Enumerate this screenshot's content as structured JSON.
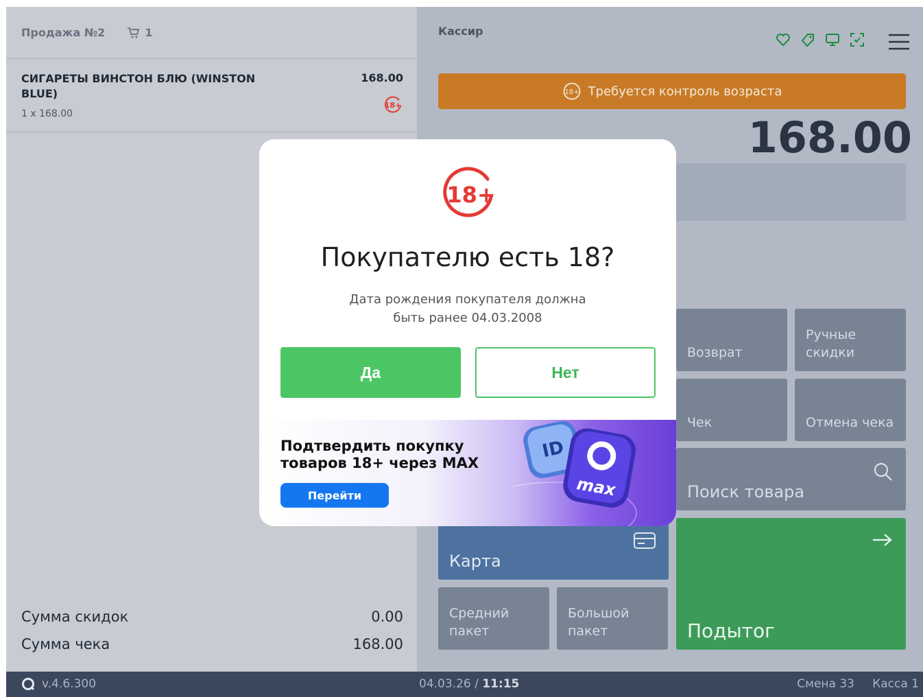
{
  "sale": {
    "title": "Продажа №2",
    "cart_count": "1"
  },
  "item": {
    "name": "СИГАРЕТЫ ВИНСТОН БЛЮ (WINSTON BLUE)",
    "price": "168.00",
    "qty_line": "1 x 168.00",
    "age_badge": "18+"
  },
  "totals": {
    "discount_label": "Сумма скидок",
    "discount_value": "0.00",
    "total_label": "Сумма чека",
    "total_value": "168.00"
  },
  "header": {
    "cashier": "Кассир"
  },
  "age_banner": {
    "badge": "18+",
    "text": "Требуется контроль возраста"
  },
  "amount": "168.00",
  "tiles": {
    "return": "Возврат",
    "manual_discounts": "Ручные скидки",
    "receipt": "Чек",
    "cancel_receipt": "Отмена чека",
    "search": "Поиск товара",
    "card": "Карта",
    "subtotal": "Подытог",
    "medium_bag": "Средний пакет",
    "large_bag": "Большой пакет"
  },
  "footer": {
    "version": "v.4.6.300",
    "date": "04.03.26",
    "time": "11:15",
    "shift": "Смена 33",
    "register": "Касса 1"
  },
  "dialog": {
    "logo_text": "18+",
    "title": "Покупателю есть 18?",
    "subtitle_line1": "Дата рождения покупателя должна",
    "subtitle_line2": "быть ранее 04.03.2008",
    "yes": "Да",
    "no": "Нет",
    "promo_line1": "Подтвердить покупку",
    "promo_line2": "товаров 18+ через MAX",
    "promo_button": "Перейти",
    "art_id": "ID",
    "art_max": "max"
  },
  "colors": {
    "accent_green": "#4cc664",
    "banner_orange": "#c97a26",
    "card_blue": "#4e72a0",
    "subtotal_green": "#3d9b59",
    "age_red": "#e53935"
  }
}
